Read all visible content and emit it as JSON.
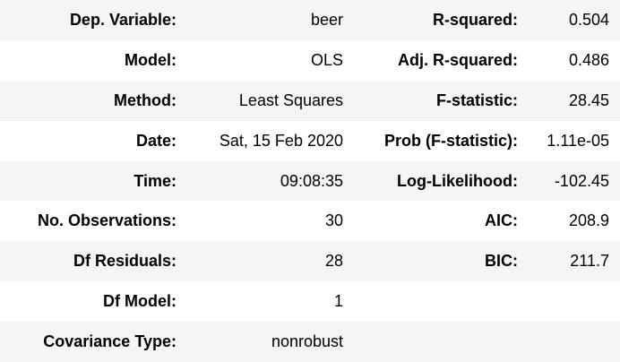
{
  "rows": [
    {
      "l1": "Dep. Variable:",
      "v1": "beer",
      "l2": "R-squared:",
      "v2": "0.504"
    },
    {
      "l1": "Model:",
      "v1": "OLS",
      "l2": "Adj. R-squared:",
      "v2": "0.486"
    },
    {
      "l1": "Method:",
      "v1": "Least Squares",
      "l2": "F-statistic:",
      "v2": "28.45"
    },
    {
      "l1": "Date:",
      "v1": "Sat, 15 Feb 2020",
      "l2": "Prob (F-statistic):",
      "v2": "1.11e-05"
    },
    {
      "l1": "Time:",
      "v1": "09:08:35",
      "l2": "Log-Likelihood:",
      "v2": "-102.45"
    },
    {
      "l1": "No. Observations:",
      "v1": "30",
      "l2": "AIC:",
      "v2": "208.9"
    },
    {
      "l1": "Df Residuals:",
      "v1": "28",
      "l2": "BIC:",
      "v2": "211.7"
    },
    {
      "l1": "Df Model:",
      "v1": "1",
      "l2": "",
      "v2": ""
    },
    {
      "l1": "Covariance Type:",
      "v1": "nonrobust",
      "l2": "",
      "v2": ""
    }
  ]
}
